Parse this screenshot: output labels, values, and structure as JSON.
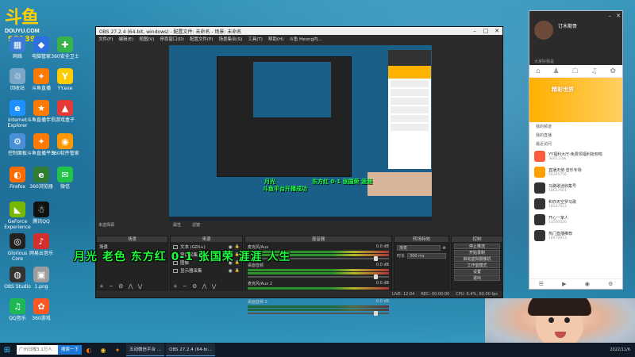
{
  "brand": {
    "logo_text": "斗鱼",
    "logo_sub": "DOUYU.COM",
    "viewer_count": "95139"
  },
  "desktop_icons": [
    {
      "label": "网络",
      "color": "#3a7bd5",
      "glyph": "▦"
    },
    {
      "label": "电脑管家",
      "color": "#2b6fe0",
      "glyph": "◆"
    },
    {
      "label": "360安全卫士",
      "color": "#38b24a",
      "glyph": "✚"
    },
    {
      "label": "回收站",
      "color": "#7aa7c7",
      "glyph": "♲"
    },
    {
      "label": "斗鱼直播",
      "color": "#ff7a00",
      "glyph": "✦"
    },
    {
      "label": "YY.exe",
      "color": "#ffcc00",
      "glyph": "Y"
    },
    {
      "label": "Internet Explorer",
      "color": "#1e90ff",
      "glyph": "e"
    },
    {
      "label": "斗鱼直播伴侣",
      "color": "#ff7a00",
      "glyph": "★"
    },
    {
      "label": "游戏盒子",
      "color": "#e53935",
      "glyph": "▲"
    },
    {
      "label": "控制面板",
      "color": "#4a90d9",
      "glyph": "⚙"
    },
    {
      "label": "斗鱼直播平台",
      "color": "#ff7a00",
      "glyph": "✦"
    },
    {
      "label": "360软件管家",
      "color": "#ff9800",
      "glyph": "◉"
    },
    {
      "label": "Firefox",
      "color": "#ff6d00",
      "glyph": "◐"
    },
    {
      "label": "360浏览器",
      "color": "#2e7d32",
      "glyph": "e"
    },
    {
      "label": "微信",
      "color": "#22c34a",
      "glyph": "✉"
    },
    {
      "label": "GeForce Experience",
      "color": "#76b900",
      "glyph": "◣"
    },
    {
      "label": "腾讯QQ",
      "color": "#111111",
      "glyph": "☃"
    },
    {
      "label": "Glorious Core",
      "color": "#222222",
      "glyph": "◎"
    },
    {
      "label": "网易云音乐",
      "color": "#d32f2f",
      "glyph": "♪"
    },
    {
      "label": "OBS Studio",
      "color": "#333333",
      "glyph": "◍"
    },
    {
      "label": "1.png",
      "color": "#9e9e9e",
      "glyph": "▣"
    },
    {
      "label": "QQ音乐",
      "color": "#1db954",
      "glyph": "♫"
    },
    {
      "label": "360游戏",
      "color": "#ff5722",
      "glyph": "✿"
    }
  ],
  "obs": {
    "title": "OBS 27.2.4 (64-bit, windows) - 配置文件: 未命名 - 场景: 未命名",
    "menu": [
      "文件(F)",
      "编辑(E)",
      "视图(V)",
      "停靠窗口(D)",
      "配置文件(P)",
      "场景集合(S)",
      "工具(T)",
      "帮助(H)",
      "斗鱼 Heong内..."
    ],
    "preview_label": "月光 老色 东方红 0-1 张国荣 涯涯 人生",
    "preview_small_1": "斗鱼平台开播成功",
    "preview_small_2": "月光",
    "preview_small_3": "东方红 0-1 张国荣 涯涯",
    "tabs_bar": "未选择源",
    "properties_label": "属性",
    "filters_label": "滤镜",
    "docks": {
      "scenes": {
        "title": "场景",
        "items": [
          "场景"
        ]
      },
      "sources": {
        "title": "来源",
        "items": [
          "文本 (GDI+)",
          "窗口采集",
          "图像",
          "显示器采集"
        ]
      },
      "mixer": {
        "title": "混音器",
        "channels": [
          {
            "name": "麦克风/Aux",
            "db": "0.0 dB",
            "active": true
          },
          {
            "name": "桌面音频",
            "db": "0.0 dB",
            "active": true
          },
          {
            "name": "麦克风/Aux 2",
            "db": "0.0 dB",
            "active": true
          },
          {
            "name": "桌面音频 2",
            "db": "0.0 dB",
            "active": false
          }
        ]
      },
      "transitions": {
        "title": "转场特效",
        "type": "渐变",
        "duration_label": "时长",
        "duration": "300 ms"
      },
      "controls": {
        "title": "控制",
        "buttons": [
          "停止推流",
          "开始录制",
          "启动虚拟摄像机",
          "工作室模式",
          "设置",
          "退出"
        ]
      }
    },
    "dock_foot": "+ − ⚙ ⋀ ⋁",
    "status": [
      "LIVE: 12:04",
      "REC: 00:00:00",
      "CPU: 6.4%, 60.00 fps"
    ]
  },
  "side_panel": {
    "username": "订木期哥",
    "status_text": "大家好我是",
    "tabs": [
      "⌂",
      "♟",
      "☖",
      "♫",
      "✿"
    ],
    "banner_title": "精彩世界",
    "menu": [
      "我的频道",
      "我的直播",
      "最近访问"
    ],
    "apps": [
      {
        "title": "YY福利大厅-免费领福利抢到啦",
        "sub": "3601,23w",
        "color": "#ff5a3c"
      },
      {
        "title": "直播天使·音乐专场",
        "sub": "56195756",
        "color": "#ffa000"
      },
      {
        "title": "马路歌迷收集号",
        "sub": "18637601",
        "color": "#333333"
      },
      {
        "title": "和你天空罗马歌",
        "sub": "18547813",
        "color": "#333333"
      },
      {
        "title": "开心一家人",
        "sub": "14500026",
        "color": "#333333"
      },
      {
        "title": "热门直播推荐",
        "sub": "18470913",
        "color": "#333333"
      }
    ],
    "bottom_icons": [
      "☰",
      "▶",
      "◉",
      "⚙"
    ]
  },
  "taskbar": {
    "start_glyph": "⊞",
    "search_placeholder": "广州日报3.1万人",
    "search_button": "搜索一下",
    "apps": [
      "五动微信平台 ...",
      "OBS 27.2.4 (64-bi..."
    ],
    "clock": "2022/11/6"
  }
}
